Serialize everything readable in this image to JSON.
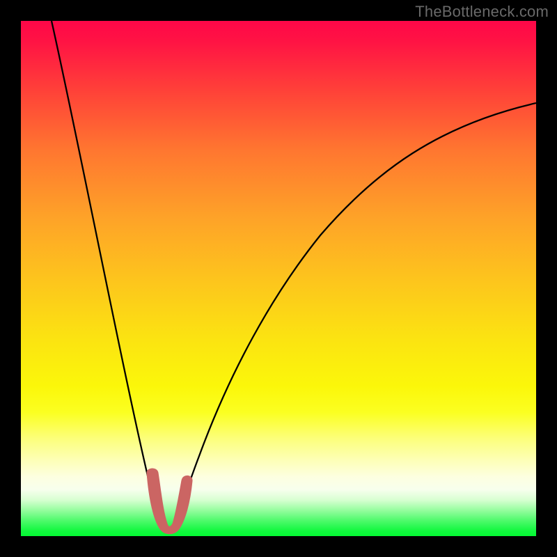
{
  "watermark": "TheBottleneck.com",
  "colors": {
    "frame": "#000000",
    "curve": "#000000",
    "blob": "#cb6563",
    "gradient_top": "#ff0748",
    "gradient_bottom": "#03f933"
  },
  "chart_data": {
    "type": "line",
    "title": "",
    "xlabel": "",
    "ylabel": "",
    "xlim": [
      0,
      100
    ],
    "ylim": [
      0,
      100
    ],
    "grid": false,
    "legend": false,
    "series": [
      {
        "name": "bottleneck-curve",
        "x": [
          6,
          8,
          10,
          12,
          14,
          16,
          18,
          20,
          22,
          24,
          25.5,
          27,
          29,
          30.5,
          32,
          35,
          40,
          45,
          50,
          55,
          60,
          65,
          70,
          75,
          80,
          85,
          90,
          95,
          100
        ],
        "y": [
          100,
          91,
          82,
          73,
          64,
          55,
          46,
          37,
          28,
          19,
          11,
          4,
          1,
          2,
          5,
          12,
          23,
          32,
          40,
          47,
          53,
          58.5,
          63.5,
          68,
          72,
          75.5,
          78.5,
          81,
          83.5
        ]
      }
    ],
    "annotations": [
      {
        "name": "optimal-region",
        "shape": "u-blob",
        "x_range": [
          24.5,
          31.5
        ],
        "y_range": [
          0.7,
          12
        ],
        "color": "#cb6563"
      }
    ]
  }
}
